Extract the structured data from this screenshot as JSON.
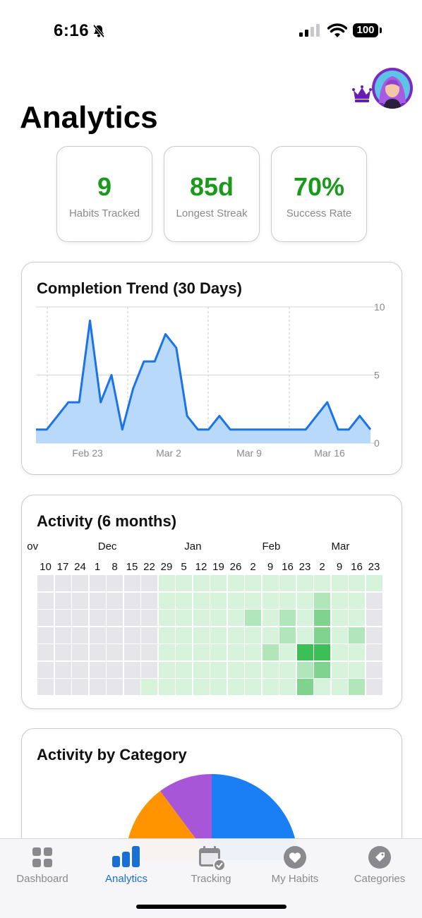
{
  "status_bar": {
    "time": "6:16",
    "battery": "100"
  },
  "header": {
    "title": "Analytics"
  },
  "stats": [
    {
      "value": "9",
      "label": "Habits Tracked"
    },
    {
      "value": "85d",
      "label": "Longest Streak"
    },
    {
      "value": "70%",
      "label": "Success Rate"
    }
  ],
  "trend": {
    "title": "Completion Trend (30 Days)",
    "x_labels": [
      "Feb 23",
      "Mar 2",
      "Mar 9",
      "Mar 16"
    ],
    "y_labels": [
      "10",
      "5",
      "0"
    ]
  },
  "chart_data": {
    "type": "area",
    "title": "Completion Trend (30 Days)",
    "x_ticks": [
      "Feb 23",
      "Mar 2",
      "Mar 9",
      "Mar 16"
    ],
    "values": [
      1,
      1,
      2,
      3,
      3,
      9,
      3,
      5,
      1,
      4,
      6,
      6,
      8,
      7,
      2,
      1,
      1,
      2,
      1,
      1,
      1,
      1,
      1,
      1,
      1,
      1,
      2,
      3,
      1,
      1,
      2,
      1
    ],
    "ylim": [
      0,
      10
    ],
    "y_ticks": [
      0,
      5,
      10
    ],
    "y_axis_position": "right",
    "color": "#1a73e8",
    "fill": "#b9d9fb",
    "grid": true
  },
  "activity": {
    "title": "Activity (6 months)",
    "month_labels": [
      "ov",
      "Dec",
      "Jan",
      "Feb",
      "Mar"
    ],
    "week_labels": [
      "10",
      "17",
      "24",
      "1",
      "8",
      "15",
      "22",
      "29",
      "5",
      "12",
      "19",
      "26",
      "2",
      "9",
      "16",
      "23",
      "2",
      "9",
      "16",
      "23"
    ],
    "levels": [
      [
        0,
        0,
        0,
        0,
        0,
        0,
        0,
        1,
        1,
        1,
        1,
        1,
        1,
        1,
        1,
        1,
        1,
        1,
        1,
        1
      ],
      [
        0,
        0,
        0,
        0,
        0,
        0,
        0,
        1,
        1,
        1,
        1,
        1,
        1,
        1,
        1,
        1,
        2,
        1,
        1,
        0
      ],
      [
        0,
        0,
        0,
        0,
        0,
        0,
        0,
        1,
        1,
        1,
        1,
        1,
        2,
        1,
        2,
        1,
        3,
        1,
        1,
        0
      ],
      [
        0,
        0,
        0,
        0,
        0,
        0,
        0,
        1,
        1,
        1,
        1,
        1,
        1,
        1,
        2,
        1,
        3,
        1,
        2,
        0
      ],
      [
        0,
        0,
        0,
        0,
        0,
        0,
        0,
        1,
        1,
        1,
        1,
        1,
        1,
        2,
        1,
        4,
        4,
        1,
        1,
        0
      ],
      [
        0,
        0,
        0,
        0,
        0,
        0,
        0,
        1,
        1,
        1,
        1,
        1,
        1,
        1,
        1,
        2,
        3,
        1,
        1,
        0
      ],
      [
        0,
        0,
        0,
        0,
        0,
        0,
        1,
        1,
        1,
        1,
        1,
        1,
        1,
        1,
        1,
        3,
        1,
        1,
        2,
        0
      ]
    ],
    "level_colors": [
      "#e5e5ea",
      "#d8f3dc",
      "#b0e6ba",
      "#7fd38f",
      "#3cbf55"
    ]
  },
  "category": {
    "title": "Activity by Category",
    "colors": [
      "#1a7ef5",
      "#ff9400",
      "#a656d6"
    ]
  },
  "tabs": [
    {
      "label": "Dashboard",
      "icon": "grid-icon",
      "active": false
    },
    {
      "label": "Analytics",
      "icon": "bar-chart-icon",
      "active": true
    },
    {
      "label": "Tracking",
      "icon": "calendar-check-icon",
      "active": false
    },
    {
      "label": "My Habits",
      "icon": "heart-icon",
      "active": false
    },
    {
      "label": "Categories",
      "icon": "tag-icon",
      "active": false
    }
  ],
  "colors": {
    "accent": "#1a6fd6",
    "success": "#1a9a1a",
    "premium": "#6a1bb3"
  }
}
